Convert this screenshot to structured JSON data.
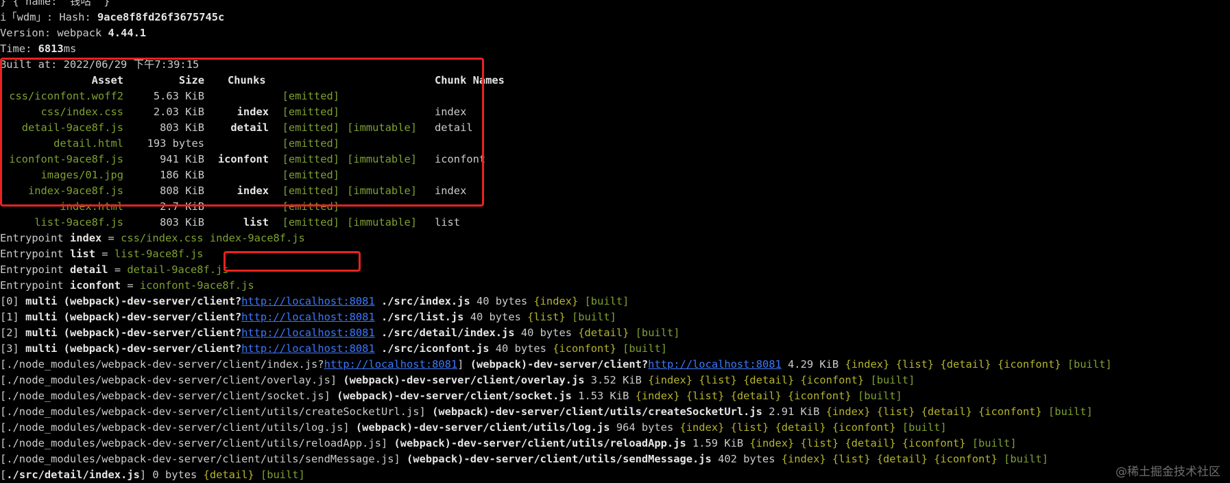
{
  "header": {
    "first_line": "} { name: '钱咕' }",
    "wdm_prefix": "i「wdm」: Hash: ",
    "hash": "9ace8f8fd26f3675745c",
    "version_label": "Version: webpack ",
    "version": "4.44.1",
    "time_label": "Time: ",
    "time_value": "6813",
    "time_unit": "ms",
    "built_at": "Built at: 2022/06/29 下午7:39:15"
  },
  "asset_table": {
    "headers": {
      "asset": "Asset",
      "size": "Size",
      "chunks": "Chunks",
      "chunk_names": "Chunk Names"
    },
    "rows": [
      {
        "asset": "css/iconfont.woff2",
        "size": "5.63 KiB",
        "chunk": "",
        "emitted": "[emitted]",
        "immutable": "",
        "name": ""
      },
      {
        "asset": "css/index.css",
        "size": "2.03 KiB",
        "chunk": "index",
        "emitted": "[emitted]",
        "immutable": "",
        "name": "index"
      },
      {
        "asset": "detail-9ace8f.js",
        "size": "803 KiB",
        "chunk": "detail",
        "emitted": "[emitted]",
        "immutable": "[immutable]",
        "name": "detail"
      },
      {
        "asset": "detail.html",
        "size": "193 bytes",
        "chunk": "",
        "emitted": "[emitted]",
        "immutable": "",
        "name": ""
      },
      {
        "asset": "iconfont-9ace8f.js",
        "size": "941 KiB",
        "chunk": "iconfont",
        "emitted": "[emitted]",
        "immutable": "[immutable]",
        "name": "iconfont"
      },
      {
        "asset": "images/01.jpg",
        "size": "186 KiB",
        "chunk": "",
        "emitted": "[emitted]",
        "immutable": "",
        "name": ""
      },
      {
        "asset": "index-9ace8f.js",
        "size": "808 KiB",
        "chunk": "index",
        "emitted": "[emitted]",
        "immutable": "[immutable]",
        "name": "index"
      },
      {
        "asset": "index.html",
        "size": "2.7 KiB",
        "chunk": "",
        "emitted": "[emitted]",
        "immutable": "",
        "name": ""
      },
      {
        "asset": "list-9ace8f.js",
        "size": "803 KiB",
        "chunk": "list",
        "emitted": "[emitted]",
        "immutable": "[immutable]",
        "name": "list"
      }
    ]
  },
  "entrypoints": [
    {
      "prefix": "Entrypoint ",
      "name": "index",
      "eq": " = ",
      "files": "css/index.css index-9ace8f.js"
    },
    {
      "prefix": "Entrypoint ",
      "name": "list",
      "eq": " = ",
      "files": "list-9ace8f.js"
    },
    {
      "prefix": "Entrypoint ",
      "name": "detail",
      "eq": " = ",
      "files": "detail-9ace8f.js"
    },
    {
      "prefix": "Entrypoint ",
      "name": "iconfont",
      "eq": " = ",
      "files": "iconfont-9ace8f.js"
    }
  ],
  "multi_lines": [
    {
      "idx": "[0] ",
      "module": "multi (webpack)-dev-server/client?",
      "url": "http://localhost:8081",
      "rest_bold": " ./src/index.js",
      "size": " 40 bytes ",
      "chunk": "{index}",
      "built": " [built]"
    },
    {
      "idx": "[1] ",
      "module": "multi (webpack)-dev-server/client?",
      "url": "http://localhost:8081",
      "rest_bold": " ./src/list.js",
      "size": " 40 bytes ",
      "chunk": "{list}",
      "built": " [built]"
    },
    {
      "idx": "[2] ",
      "module": "multi (webpack)-dev-server/client?",
      "url": "http://localhost:8081",
      "rest_bold": " ./src/detail/index.js",
      "size": " 40 bytes ",
      "chunk": "{detail}",
      "built": " [built]"
    },
    {
      "idx": "[3] ",
      "module": "multi (webpack)-dev-server/client?",
      "url": "http://localhost:8081",
      "rest_bold": " ./src/iconfont.js",
      "size": " 40 bytes ",
      "chunk": "{iconfont}",
      "built": " [built]"
    }
  ],
  "client_index_line": {
    "path": "[./node_modules/webpack-dev-server/client/index.js?",
    "url1": "http://localhost:8081",
    "close": "] ",
    "module": "(webpack)-dev-server/client?",
    "url2": "http://localhost:8081",
    "size": " 4.29 KiB ",
    "chunks": "{index} {list} {detail} {iconfont}",
    "built": " [built]"
  },
  "module_lines": [
    {
      "path": "[./node_modules/webpack-dev-server/client/overlay.js] ",
      "module": "(webpack)-dev-server/client/overlay.js",
      "size": " 3.52 KiB ",
      "chunks": "{index} {list} {detail} {iconfont}",
      "built": " [built]"
    },
    {
      "path": "[./node_modules/webpack-dev-server/client/socket.js] ",
      "module": "(webpack)-dev-server/client/socket.js",
      "size": " 1.53 KiB ",
      "chunks": "{index} {list} {detail} {iconfont}",
      "built": " [built]"
    },
    {
      "path": "[./node_modules/webpack-dev-server/client/utils/createSocketUrl.js] ",
      "module": "(webpack)-dev-server/client/utils/createSocketUrl.js",
      "size": " 2.91 KiB ",
      "chunks": "{index} {list} {detail} {iconfont}",
      "built": " [built]"
    },
    {
      "path": "[./node_modules/webpack-dev-server/client/utils/log.js] ",
      "module": "(webpack)-dev-server/client/utils/log.js",
      "size": " 964 bytes ",
      "chunks": "{index} {list} {detail} {iconfont}",
      "built": " [built]"
    },
    {
      "path": "[./node_modules/webpack-dev-server/client/utils/reloadApp.js] ",
      "module": "(webpack)-dev-server/client/utils/reloadApp.js",
      "size": " 1.59 KiB ",
      "chunks": "{index} {list} {detail} {iconfont}",
      "built": " [built]"
    },
    {
      "path": "[./node_modules/webpack-dev-server/client/utils/sendMessage.js] ",
      "module": "(webpack)-dev-server/client/utils/sendMessage.js",
      "size": " 402 bytes ",
      "chunks": "{index} {list} {detail} {iconfont}",
      "built": " [built]"
    }
  ],
  "last_line": {
    "open": "[",
    "path": "./src/detail/index.js",
    "close": "] 0 bytes ",
    "chunk": "{detail}",
    "built": " [built]"
  },
  "watermark": "@稀土掘金技术社区",
  "colors": {
    "background": "#000000",
    "text": "#cccccc",
    "green": "#7fa131",
    "yellow": "#b5b52e",
    "link": "#3b78ff",
    "highlight": "#e8231f"
  }
}
